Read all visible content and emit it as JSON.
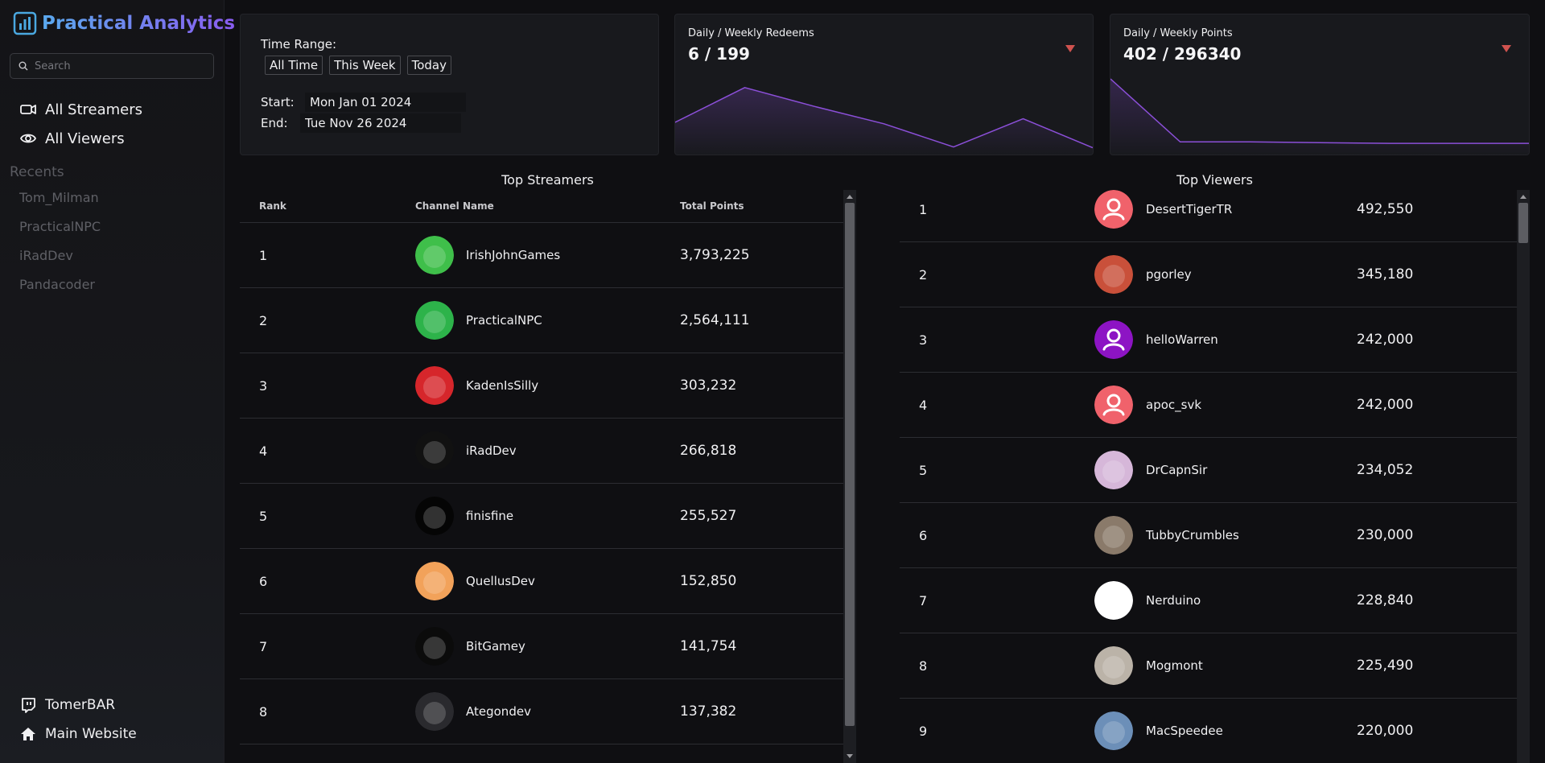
{
  "app": {
    "brand": "Practical Analytics"
  },
  "sidebar": {
    "search_placeholder": "Search",
    "nav": [
      {
        "label": "All Streamers",
        "icon": "camera-icon"
      },
      {
        "label": "All Viewers",
        "icon": "eye-icon"
      }
    ],
    "recents_title": "Recents",
    "recents": [
      "Tom_Milman",
      "PracticalNPC",
      "iRadDev",
      "Pandacoder"
    ],
    "bottom": [
      {
        "label": "TomerBAR",
        "icon": "twitch-icon"
      },
      {
        "label": "Main Website",
        "icon": "home-icon"
      }
    ]
  },
  "time_range": {
    "label": "Time Range:",
    "buttons": [
      "All Time",
      "This Week",
      "Today"
    ],
    "start_label": "Start:",
    "start_value": "Mon Jan 01 2024",
    "end_label": "End:",
    "end_value": "Tue Nov 26 2024"
  },
  "stats": {
    "redeems": {
      "title": "Daily / Weekly Redeems",
      "value": "6 / 199",
      "sparkline": [
        40,
        88,
        62,
        38,
        6,
        45,
        5
      ]
    },
    "points": {
      "title": "Daily / Weekly Points",
      "value": "402 / 296340",
      "sparkline": [
        100,
        13,
        13,
        12,
        11,
        11,
        11
      ]
    },
    "line_color": "#8b4fd8",
    "toggle_color": "#d0524f"
  },
  "top_streamers": {
    "title": "Top Streamers",
    "columns": [
      "Rank",
      "Channel Name",
      "Total Points"
    ],
    "rows": [
      {
        "rank": "1",
        "name": "IrishJohnGames",
        "points": "3,793,225",
        "avatar_bg": "#3fbf4a"
      },
      {
        "rank": "2",
        "name": "PracticalNPC",
        "points": "2,564,111",
        "avatar_bg": "#2db34a"
      },
      {
        "rank": "3",
        "name": "KadenIsSilly",
        "points": "303,232",
        "avatar_bg": "#d6262b"
      },
      {
        "rank": "4",
        "name": "iRadDev",
        "points": "266,818",
        "avatar_bg": "#111111"
      },
      {
        "rank": "5",
        "name": "finisfine",
        "points": "255,527",
        "avatar_bg": "#050505"
      },
      {
        "rank": "6",
        "name": "QuellusDev",
        "points": "152,850",
        "avatar_bg": "#f2a25a"
      },
      {
        "rank": "7",
        "name": "BitGamey",
        "points": "141,754",
        "avatar_bg": "#0b0b0b"
      },
      {
        "rank": "8",
        "name": "Ategondev",
        "points": "137,382",
        "avatar_bg": "#2a2a2e"
      }
    ]
  },
  "top_viewers": {
    "title": "Top Viewers",
    "rows": [
      {
        "rank": "1",
        "name": "DesertTigerTR",
        "points": "492,550",
        "avatar_bg": "#f0626b"
      },
      {
        "rank": "2",
        "name": "pgorley",
        "points": "345,180",
        "avatar_bg": "#c9503a"
      },
      {
        "rank": "3",
        "name": "helloWarren",
        "points": "242,000",
        "avatar_bg": "#8d14c4"
      },
      {
        "rank": "4",
        "name": "apoc_svk",
        "points": "242,000",
        "avatar_bg": "#f0626b"
      },
      {
        "rank": "5",
        "name": "DrCapnSir",
        "points": "234,052",
        "avatar_bg": "#d6b7d9"
      },
      {
        "rank": "6",
        "name": "TubbyCrumbles",
        "points": "230,000",
        "avatar_bg": "#8a7a6a"
      },
      {
        "rank": "7",
        "name": "Nerduino",
        "points": "228,840",
        "avatar_bg": "#ffffff"
      },
      {
        "rank": "8",
        "name": "Mogmont",
        "points": "225,490",
        "avatar_bg": "#bbb3a8"
      },
      {
        "rank": "9",
        "name": "MacSpeedee",
        "points": "220,000",
        "avatar_bg": "#6c8fb8"
      }
    ]
  }
}
